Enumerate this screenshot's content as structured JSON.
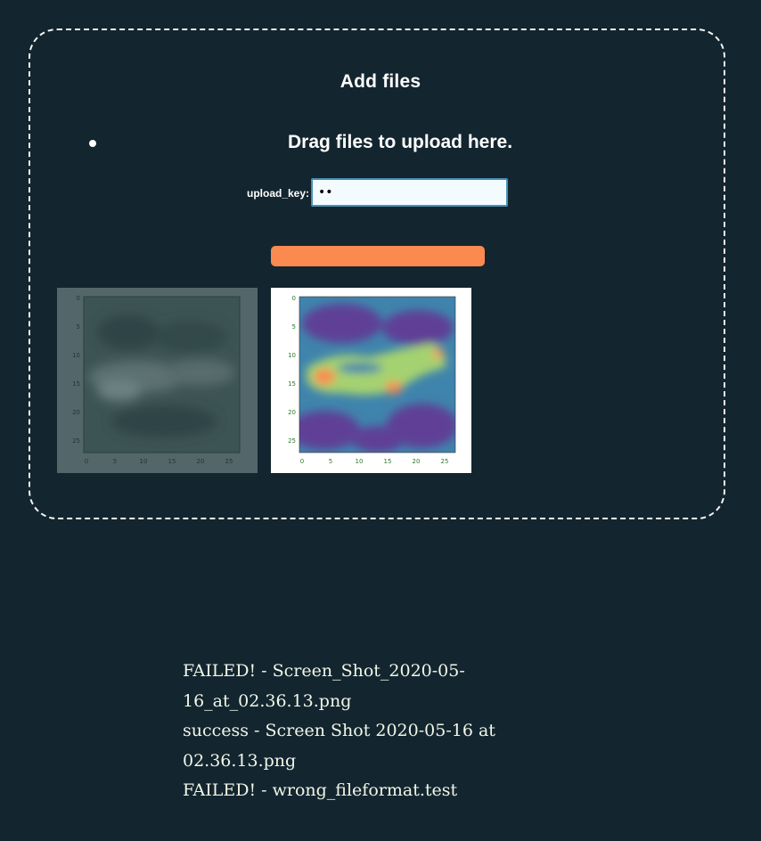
{
  "dropzone": {
    "title": "Add files",
    "instruction": "Drag files to upload here.",
    "key_label": "upload_key:",
    "key_value": "••",
    "button_label": ""
  },
  "previews": [
    {
      "name": "greyscale-preview",
      "axis_ticks": [
        "0",
        "5",
        "10",
        "15",
        "20",
        "25"
      ]
    },
    {
      "name": "heatmap-preview",
      "axis_ticks": [
        "0",
        "5",
        "10",
        "15",
        "20",
        "25"
      ]
    }
  ],
  "log": [
    "FAILED! - Screen_Shot_2020-05-16_at_02.36.13.png",
    "success - Screen Shot 2020-05-16 at 02.36.13.png",
    "FAILED! - wrong_fileformat.test"
  ],
  "colors": {
    "background": "#13262f",
    "accent": "#fb8a50",
    "heatmap_low": "#5e3f96",
    "heatmap_mid": "#3f84ad",
    "heatmap_high": "#a5d26f",
    "heatmap_peak": "#fb8a50"
  }
}
